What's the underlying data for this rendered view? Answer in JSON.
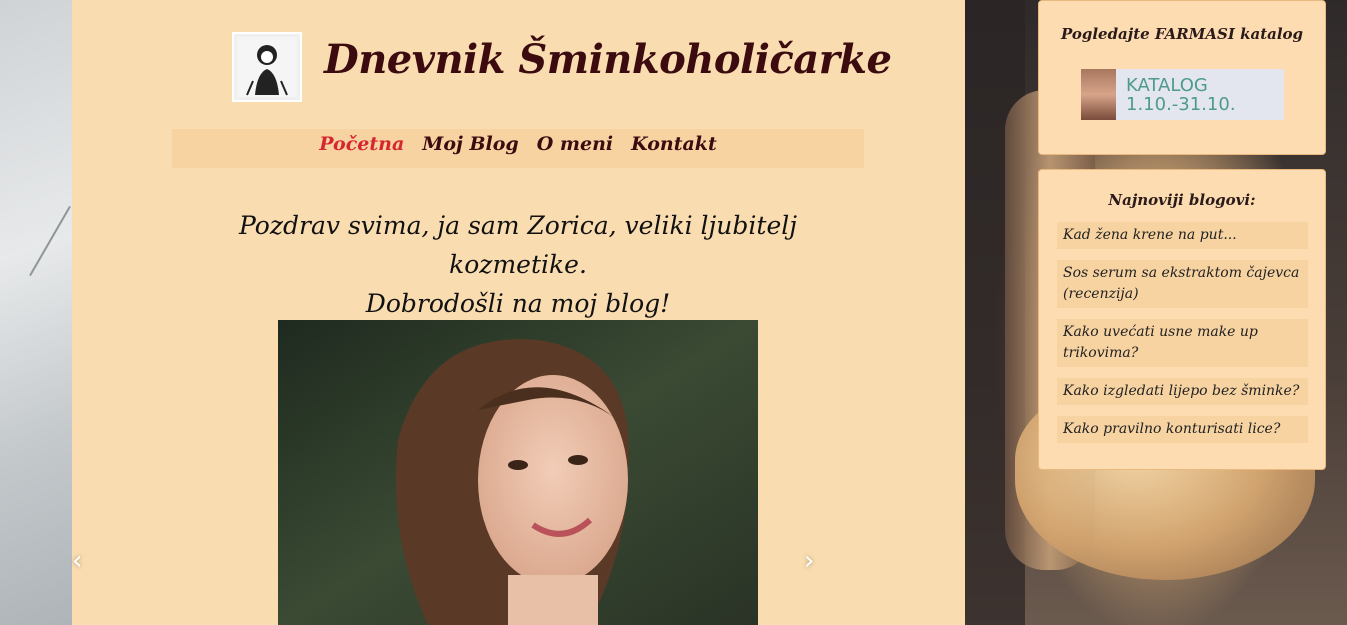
{
  "site": {
    "title": "Dnevnik Šminkoholičarke"
  },
  "nav": {
    "items": [
      {
        "label": "Početna"
      },
      {
        "label": "Moj Blog"
      },
      {
        "label": "O meni"
      },
      {
        "label": "Kontakt"
      }
    ]
  },
  "main": {
    "greeting_line1": "Pozdrav svima, ja sam Zorica, veliki ljubitelj kozmetike.",
    "greeting_line2": "Dobrodošli na moj blog!",
    "carousel": {
      "prev": "‹",
      "next": "›"
    }
  },
  "sidebar": {
    "catalog_widget": {
      "title": "Pogledajte FARMASI katalog",
      "catalog_label": "KATALOG",
      "catalog_dates": "1.10.-31.10."
    },
    "latest_widget": {
      "title": "Najnoviji blogovi:",
      "posts": [
        "Kad žena krene na put...",
        "Sos serum sa ekstraktom čajevca (recenzija)",
        "Kako uvećati usne make up trikovima?",
        "Kako izgledati lijepo bez šminke?",
        "Kako pravilno konturisati lice?"
      ]
    }
  }
}
